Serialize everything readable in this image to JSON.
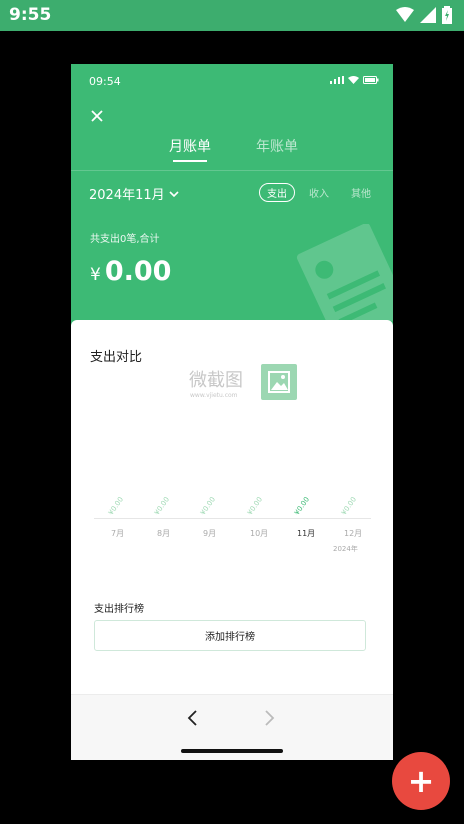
{
  "device_status": {
    "time": "9:55"
  },
  "app_status": {
    "time": "09:54"
  },
  "tabs": {
    "month": "月账单",
    "year": "年账单"
  },
  "filter": {
    "date": "2024年11月",
    "types": [
      "支出",
      "收入",
      "其他"
    ],
    "active_type": "支出"
  },
  "summary": {
    "text": "共支出0笔,合计",
    "currency": "¥",
    "amount": "0.00"
  },
  "card": {
    "title": "支出对比",
    "watermark_text": "微截图",
    "watermark_url": "www.vjietu.com",
    "chart_data": {
      "type": "bar",
      "categories": [
        "7月",
        "8月",
        "9月",
        "10月",
        "11月",
        "12月"
      ],
      "values": [
        0,
        0,
        0,
        0,
        0,
        0
      ],
      "value_labels": [
        "¥0.00",
        "¥0.00",
        "¥0.00",
        "¥0.00",
        "¥0.00",
        "¥0.00"
      ],
      "highlight": "11月",
      "year_label": "2024年"
    },
    "ranking_title": "支出排行榜",
    "ranking_button": "添加排行榜"
  },
  "colors": {
    "accent": "#3dba75",
    "fab": "#e8493f"
  },
  "fab": {
    "label": "+"
  }
}
